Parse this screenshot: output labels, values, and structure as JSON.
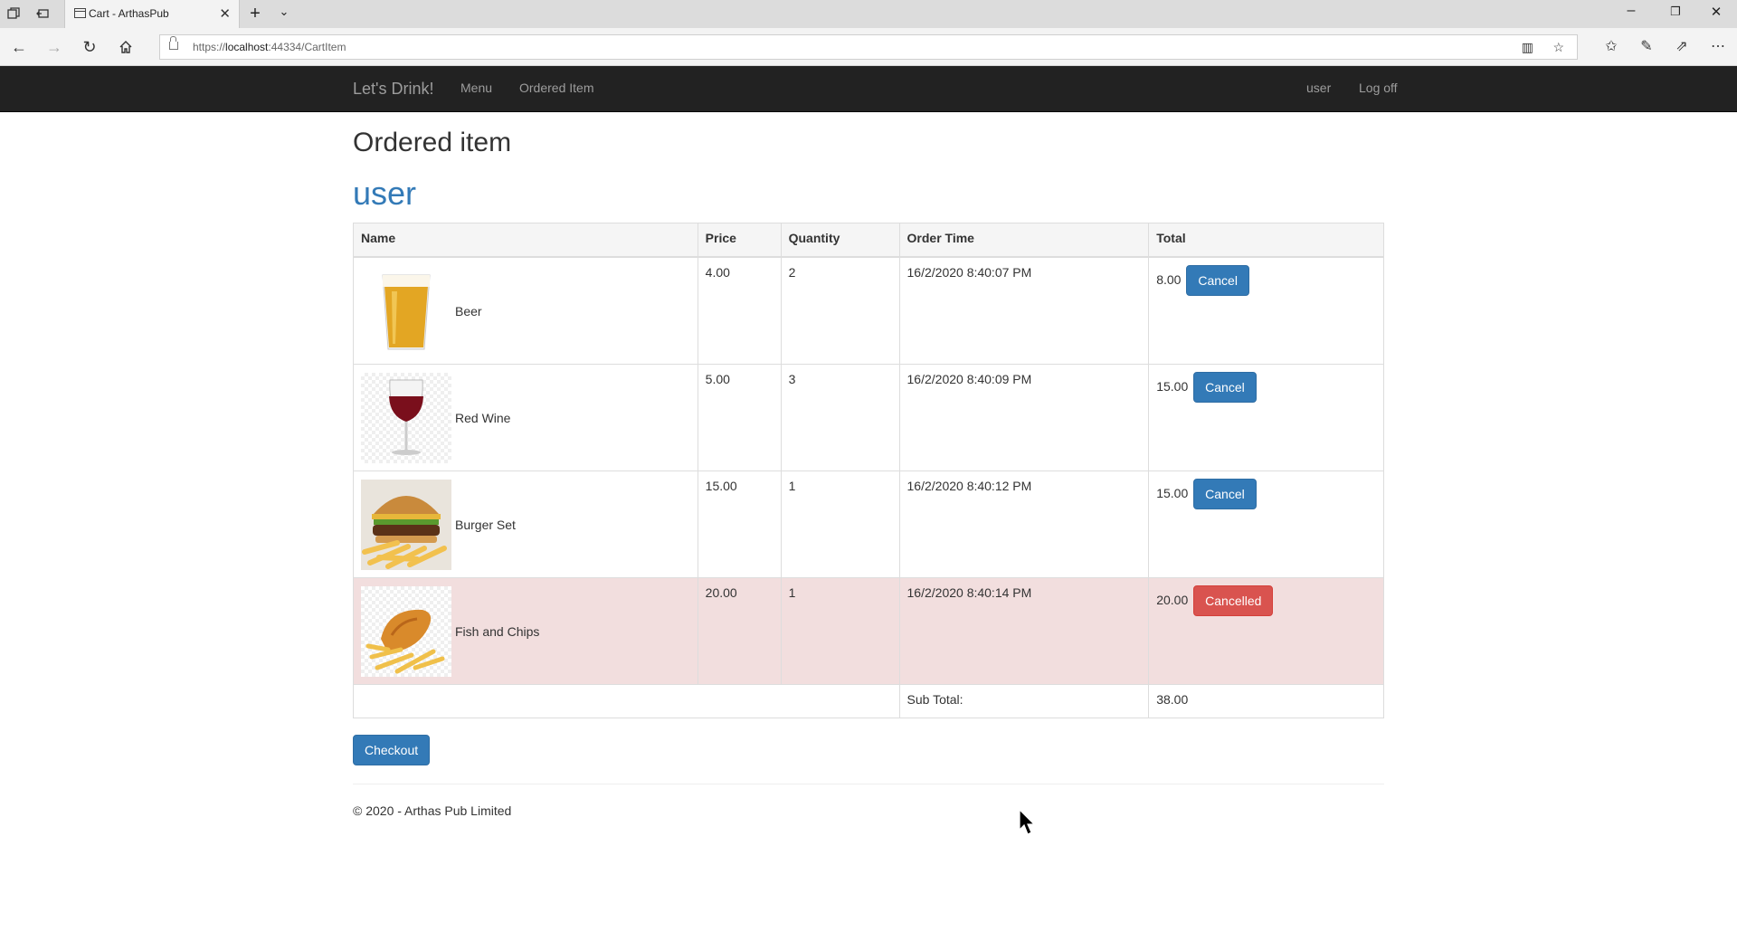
{
  "browser": {
    "tab_title": "Cart - ArthasPub",
    "url_prefix": "https://",
    "url_host": "localhost",
    "url_rest": ":44334/CartItem"
  },
  "nav": {
    "brand": "Let's Drink!",
    "links": [
      "Menu",
      "Ordered Item"
    ],
    "user": "user",
    "logoff": "Log off"
  },
  "page": {
    "title": "Ordered item",
    "username": "user"
  },
  "table": {
    "headers": [
      "Name",
      "Price",
      "Quantity",
      "Order Time",
      "Total"
    ],
    "rows": [
      {
        "name": "Beer",
        "price": "4.00",
        "quantity": "2",
        "order_time": "16/2/2020 8:40:07 PM",
        "total": "8.00",
        "action": "Cancel",
        "image": "beer-image"
      },
      {
        "name": "Red Wine",
        "price": "5.00",
        "quantity": "3",
        "order_time": "16/2/2020 8:40:09 PM",
        "total": "15.00",
        "action": "Cancel",
        "image": "red-wine-image"
      },
      {
        "name": "Burger Set",
        "price": "15.00",
        "quantity": "1",
        "order_time": "16/2/2020 8:40:12 PM",
        "total": "15.00",
        "action": "Cancel",
        "image": "burger-image"
      },
      {
        "name": "Fish and Chips",
        "price": "20.00",
        "quantity": "1",
        "order_time": "16/2/2020 8:40:14 PM",
        "total": "20.00",
        "action": "Cancelled",
        "image": "fish-and-chips-image"
      }
    ],
    "subtotal_label": "Sub Total:",
    "subtotal_value": "38.00"
  },
  "actions": {
    "checkout": "Checkout"
  },
  "footer": {
    "text": "© 2020 - Arthas Pub Limited"
  },
  "colors": {
    "navbar_bg": "#222222",
    "primary": "#337ab7",
    "danger": "#d9534f",
    "cancelled_row": "#f2dede"
  }
}
